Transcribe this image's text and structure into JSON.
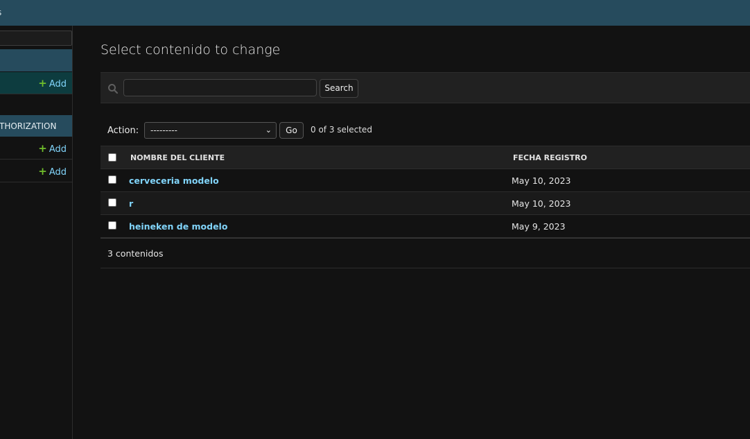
{
  "header": {
    "brand_fragment": "s"
  },
  "sidebar": {
    "filter_placeholder": "",
    "modules": [
      {
        "caption": "",
        "models": [
          {
            "name": "",
            "add_label": "Add",
            "selected": true
          }
        ]
      },
      {
        "caption": "THORIZATION",
        "models": [
          {
            "name": "",
            "add_label": "Add",
            "selected": false
          },
          {
            "name": "",
            "add_label": "Add",
            "selected": false
          }
        ]
      }
    ]
  },
  "content": {
    "title": "Select contenido to change",
    "search": {
      "value": "",
      "button_label": "Search"
    },
    "actions": {
      "label": "Action:",
      "selected_option": "---------",
      "go_label": "Go",
      "counter": "0 of 3 selected"
    },
    "table": {
      "columns": [
        "NOMBRE DEL CLIENTE",
        "FECHA REGISTRO"
      ],
      "rows": [
        {
          "nombre": "cerveceria modelo",
          "fecha": "May 10, 2023"
        },
        {
          "nombre": "r",
          "fecha": "May 10, 2023"
        },
        {
          "nombre": "heineken de modelo",
          "fecha": "May 9, 2023"
        }
      ]
    },
    "paginator": "3 contenidos"
  },
  "colors": {
    "header_bg": "#264b5d",
    "link": "#81d4fa",
    "add_plus": "#70bf2b",
    "selected_row": "#0d3c3f",
    "body_bg": "#121212"
  },
  "icons": {
    "search": "search-icon",
    "add": "plus-icon",
    "select_arrow": "chevron-down-icon"
  }
}
